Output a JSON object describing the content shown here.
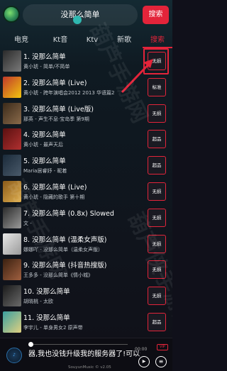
{
  "header": {
    "search_value": "没那么简单",
    "search_button": "搜索"
  },
  "tabs": [
    {
      "label": "电竞"
    },
    {
      "label": "Kt音"
    },
    {
      "label": "Ktv"
    },
    {
      "label": "新歌"
    },
    {
      "label": "搜索"
    }
  ],
  "songs": [
    {
      "title": "1. 没那么简单",
      "subtitle": "黄小琥 - 简单/不简单",
      "quality": "无损"
    },
    {
      "title": "2. 没那么简单 (Live)",
      "subtitle": "黄小琥 - 跨年演唱会2012 2013 华语篇2",
      "quality": "标准"
    },
    {
      "title": "3. 没那么简单 (Live版)",
      "subtitle": "那英 - 声生不息·宝岛季 第9期",
      "quality": "无损"
    },
    {
      "title": "4. 没那么简单",
      "subtitle": "黄小琥 - 最声天后",
      "quality": "超品"
    },
    {
      "title": "5. 没那么简单",
      "subtitle": "Maria居睿妤 - 昵着",
      "quality": "超品"
    },
    {
      "title": "6. 没那么简单 (Live)",
      "subtitle": "黄小琥 - 隐藏的歌手 第十期",
      "quality": "无损"
    },
    {
      "title": "7. 没那么简单 (0.8x) Slowed",
      "subtitle": "文 -",
      "quality": "无损"
    },
    {
      "title": "8. 没那么简单 (温柔女声版)",
      "subtitle": "娜娜吖 - 没那么简单（温柔女声版）",
      "quality": "无损"
    },
    {
      "title": "9. 没那么简单 (抖音热搜版)",
      "subtitle": "王多多 - 没那么简单《情小城》",
      "quality": "无损"
    },
    {
      "title": "10. 没那么简单",
      "subtitle": "胡晓桃 - 太欧",
      "quality": "无损"
    },
    {
      "title": "11. 没那么简单",
      "subtitle": "李宇儿 - 单身男女2 原声带",
      "quality": "超品"
    }
  ],
  "watermark": [
    "葫芦手游网",
    "葫芦手游网",
    "葫芦侠手游网"
  ],
  "player": {
    "marquee": "器,我也没钱升级我的服务器了!可以分享",
    "time": "00:00",
    "vip": "VIP",
    "version": "SouyunMusic © v2.05"
  },
  "colors": {
    "accent": "#e3243a",
    "teal": "#2fb8b0"
  }
}
